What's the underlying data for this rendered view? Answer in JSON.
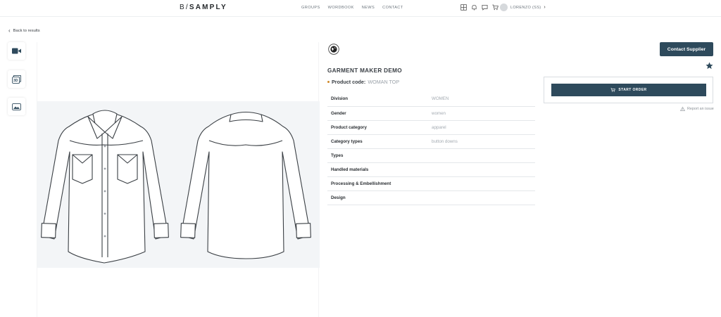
{
  "header": {
    "logo_left": "B/",
    "logo_right": "SAMPLY",
    "nav": [
      "GROUPS",
      "WORDBOOK",
      "NEWS",
      "CONTACT"
    ],
    "icons": [
      "layout-icon",
      "bell-icon",
      "chat-icon",
      "cart-icon"
    ],
    "user_name": "LORENZO (SS)"
  },
  "back_link": "Back to results",
  "thumbnails": [
    "video-icon",
    "3d-icon",
    "image-icon"
  ],
  "product": {
    "title": "GARMENT MAKER DEMO",
    "code_label": "Product code:",
    "code_value": "WOMAN TOP",
    "attributes": [
      {
        "key": "Division",
        "value": "WOMEN"
      },
      {
        "key": "Gender",
        "value": "women"
      },
      {
        "key": "Product category",
        "value": "apparel"
      },
      {
        "key": "Category types",
        "value": "button downs"
      },
      {
        "key": "Types",
        "value": ""
      },
      {
        "key": "Handled materials",
        "value": ""
      },
      {
        "key": "Processing & Embellishment",
        "value": ""
      },
      {
        "key": "Design",
        "value": ""
      }
    ]
  },
  "actions": {
    "contact_supplier": "Contact Supplier",
    "start_order": "START ORDER",
    "report_issue": "Report an issue"
  },
  "colors": {
    "primary": "#2e4a5c",
    "accent_dot": "#d08a2a"
  }
}
